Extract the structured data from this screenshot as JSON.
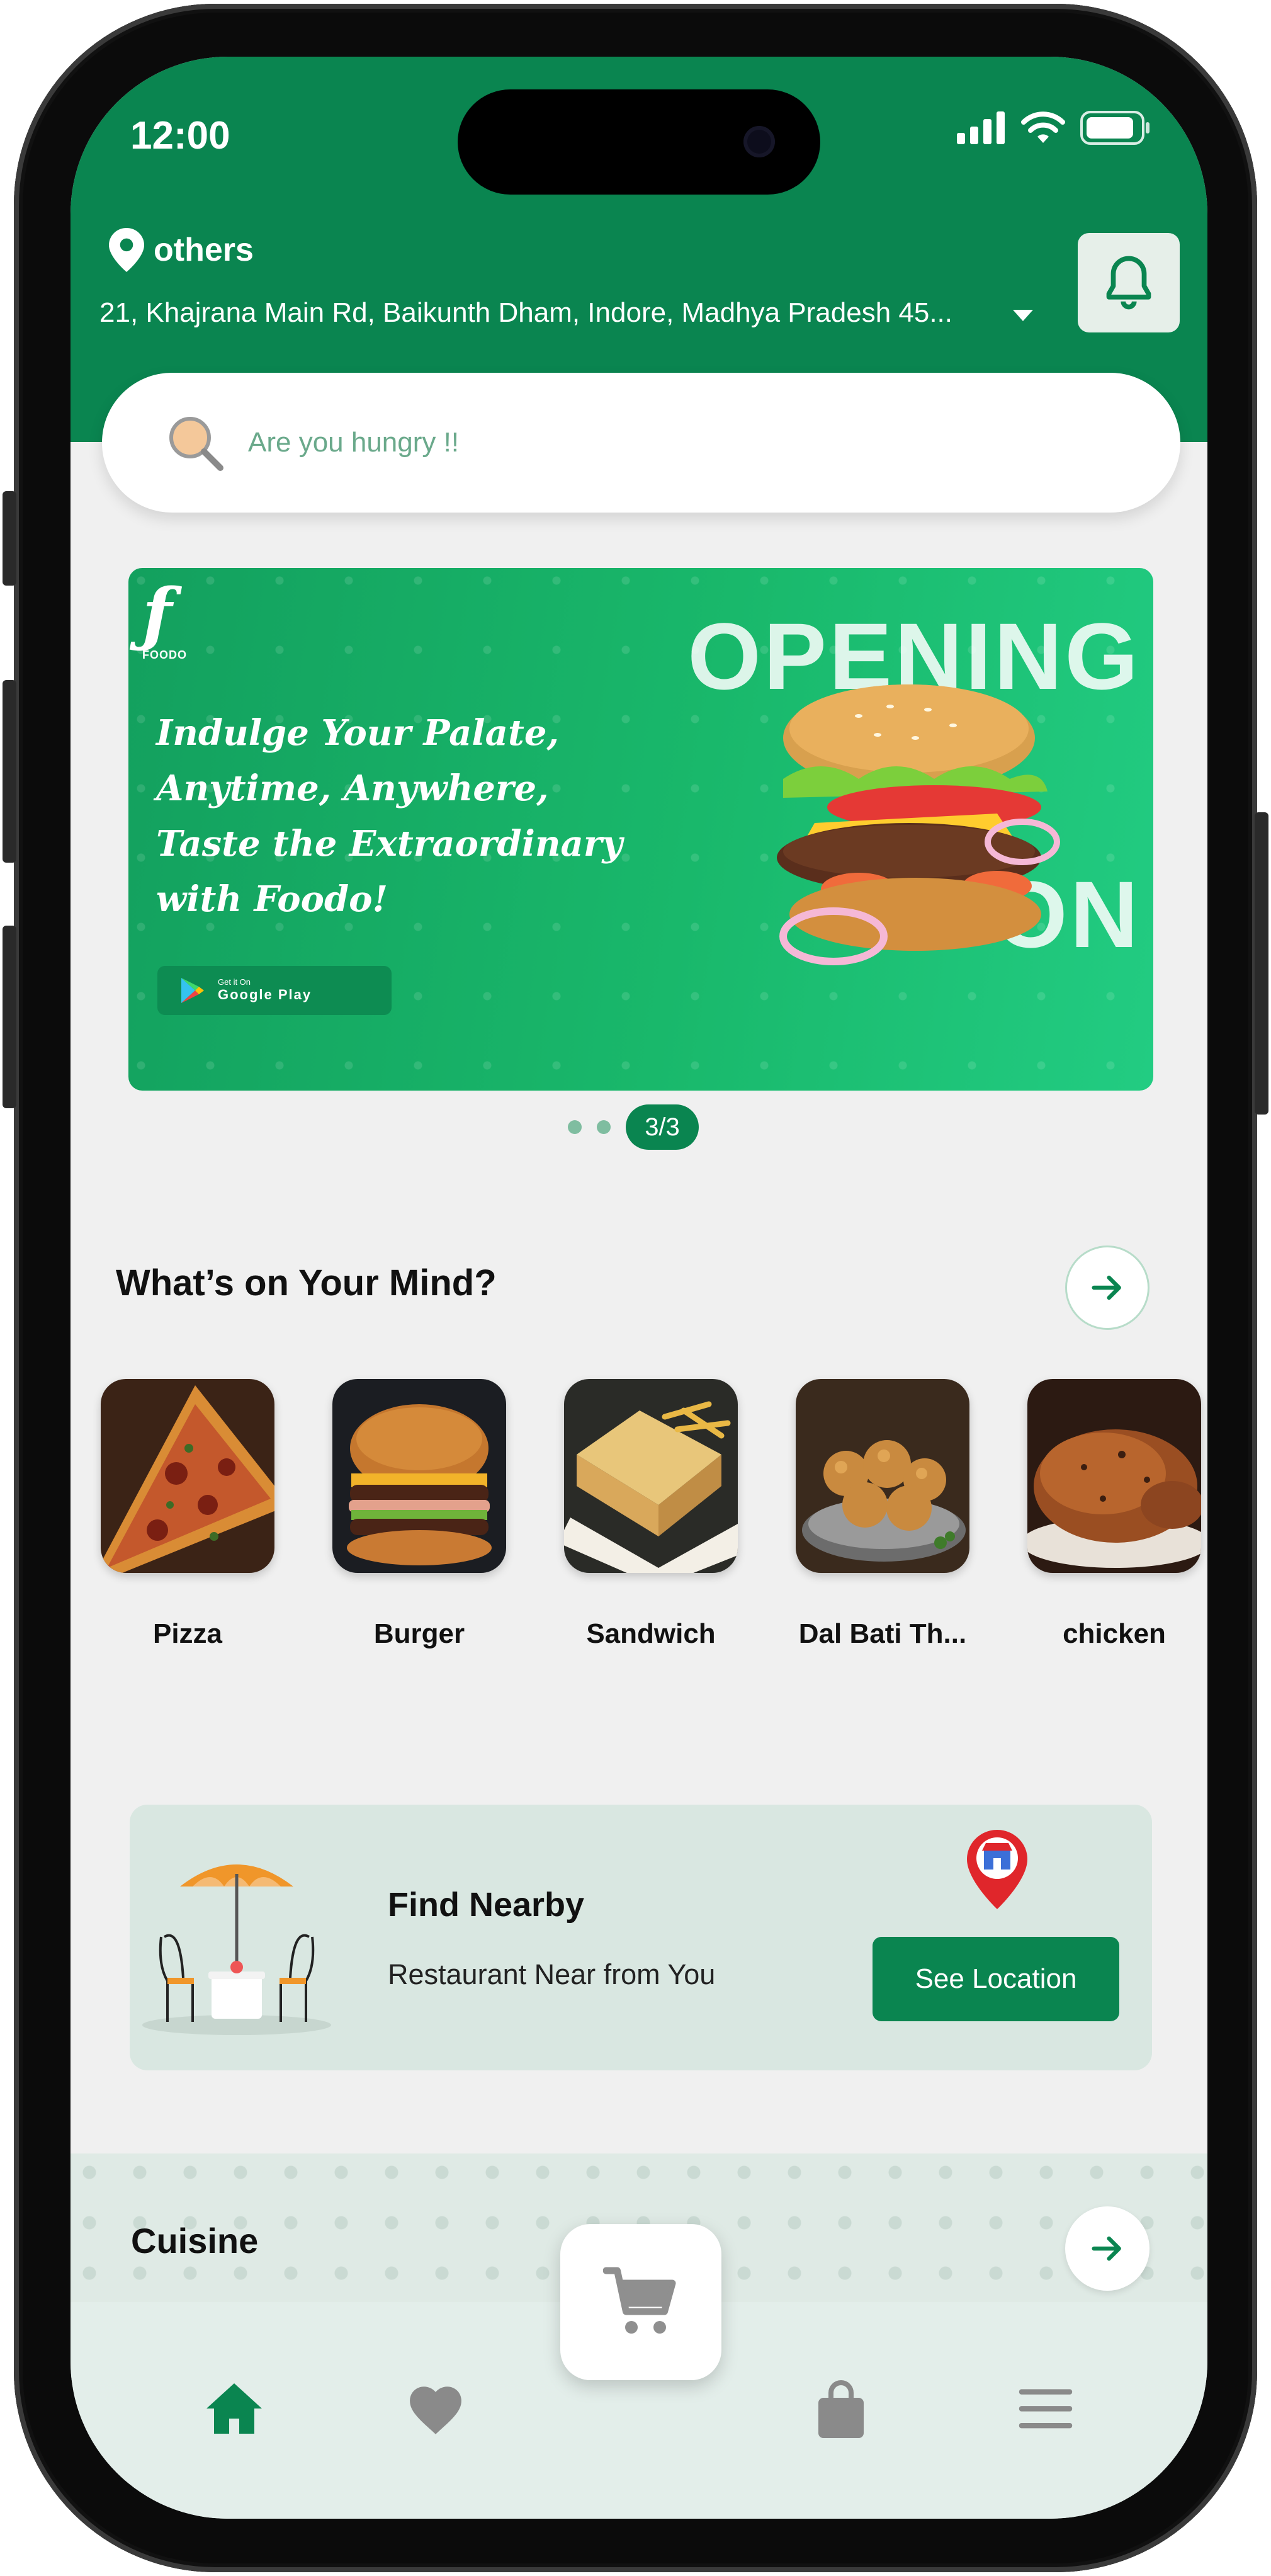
{
  "status_bar": {
    "time": "12:00"
  },
  "location": {
    "label": "others",
    "address": "21, Khajrana Main Rd, Baikunth Dham, Indore, Madhya Pradesh 45..."
  },
  "search": {
    "placeholder": "Are you hungry !!"
  },
  "banner": {
    "brand_name": "FOODO",
    "tagline_lines": [
      "Indulge Your Palate,",
      "Anytime, Anywhere,",
      "Taste the Extraordinary",
      "with Foodo!"
    ],
    "store_badge_small": "Get it On",
    "store_badge_big": "Google Play",
    "promo_lines": [
      "OPENING",
      "SOON"
    ],
    "page_indicator": "3/3"
  },
  "whats_on_mind": {
    "title": "What’s on Your Mind?",
    "categories": [
      {
        "label": "Pizza"
      },
      {
        "label": "Burger"
      },
      {
        "label": "Sandwich"
      },
      {
        "label": "Dal Bati Th..."
      },
      {
        "label": "chicken"
      }
    ]
  },
  "find_nearby": {
    "title": "Find Nearby",
    "subtitle": "Restaurant Near from You",
    "button": "See Location"
  },
  "cuisine": {
    "title": "Cuisine"
  },
  "bottom_nav": {
    "items": [
      "home-icon",
      "heart-icon",
      "cart-icon",
      "bag-icon",
      "menu-icon"
    ],
    "active": "home-icon"
  },
  "colors": {
    "primary": "#0A8550",
    "screen_background": "#F0F0F0",
    "nav_background": "#E3EEEA"
  }
}
